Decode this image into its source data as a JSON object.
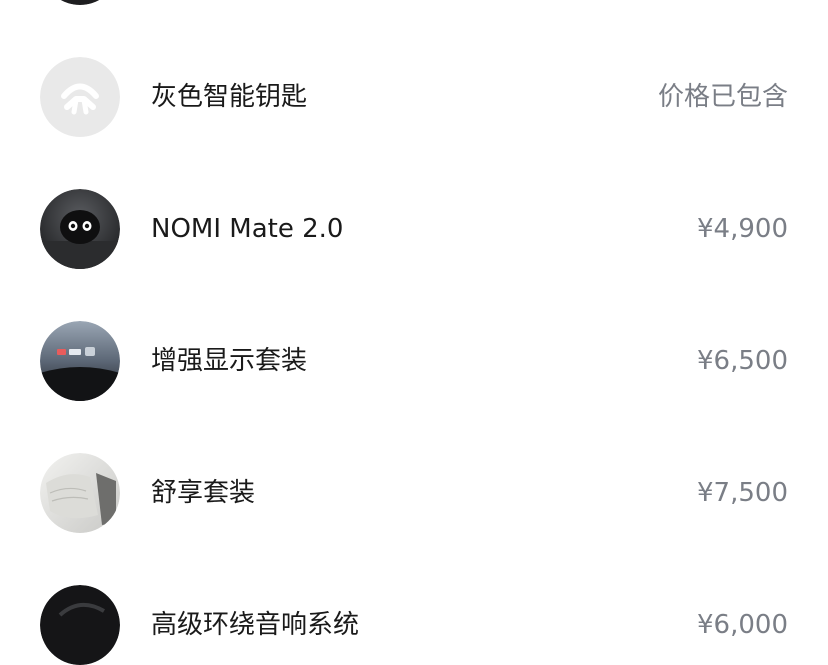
{
  "options": [
    {
      "label": "",
      "price": "",
      "thumb_icon": "dark-item-thumbnail"
    },
    {
      "label": "灰色智能钥匙",
      "price": "价格已包含",
      "thumb_icon": "nio-logo-key-thumbnail"
    },
    {
      "label": "NOMI Mate 2.0",
      "price": "¥4,900",
      "thumb_icon": "nomi-robot-thumbnail"
    },
    {
      "label": "增强显示套装",
      "price": "¥6,500",
      "thumb_icon": "hud-display-thumbnail"
    },
    {
      "label": "舒享套装",
      "price": "¥7,500",
      "thumb_icon": "seat-comfort-thumbnail"
    },
    {
      "label": "高级环绕音响系统",
      "price": "¥6,000",
      "thumb_icon": "audio-system-thumbnail"
    }
  ]
}
